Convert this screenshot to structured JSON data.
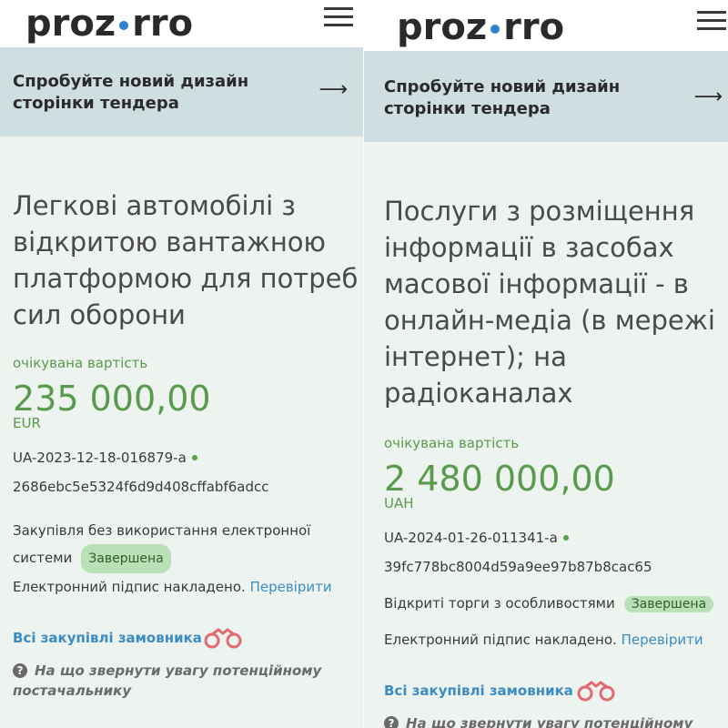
{
  "panels": [
    {
      "logo": {
        "left": "proz",
        "right": "rro"
      },
      "banner": {
        "text": "Спробуйте новий дизайн сторінки тендера",
        "arrow": "⟶"
      },
      "title": "Легкові автомобілі з відкритою вантажною платформою для потреб сил оборони",
      "expected_label": "очікувана вартість",
      "amount": "235 000,00",
      "currency": "EUR",
      "tender_id": "UA-2023-12-18-016879-a",
      "hash": "2686ebc5e5324f6d9d408cffabf6adcc",
      "procurement_type": "Закупівля без використання електронної системи",
      "status": "Завершена",
      "signature_text": "Електронний підпис накладено.",
      "verify_link": "Перевірити",
      "buyer_link": "Всі закупівлі замовника",
      "hint": "На що звернути увагу потенційному постачальнику"
    },
    {
      "logo": {
        "left": "proz",
        "right": "rro"
      },
      "banner": {
        "text": "Спробуйте новий дизайн сторінки тендера",
        "arrow": "⟶"
      },
      "title": "Послуги з розміщення інформації в засобах масової інформації - в онлайн-медіа (в мережі інтернет); на радіоканалах",
      "expected_label": "очікувана вартість",
      "amount": "2 480 000,00",
      "currency": "UAH",
      "tender_id": "UA-2024-01-26-011341-a",
      "hash": "39fc778bc8004d59a9ee97b87b8cac65",
      "procurement_type": "Відкриті торги з особливостями",
      "status": "Завершена",
      "signature_text": "Електронний підпис накладено.",
      "verify_link": "Перевірити",
      "buyer_link": "Всі закупівлі замовника",
      "hint": "На що звернути увагу потенційному постачальнику"
    }
  ],
  "colors": {
    "accent_green": "#5a9a4e",
    "link_blue": "#3c8cc4",
    "banner_bg": "#cfdee1",
    "page_bg": "#edf3ee",
    "badge_bg": "#b9e0b6"
  },
  "icons": [
    "menu-icon",
    "arrow-right-icon",
    "status-dot-icon",
    "binoculars-icon",
    "question-circle-icon"
  ]
}
